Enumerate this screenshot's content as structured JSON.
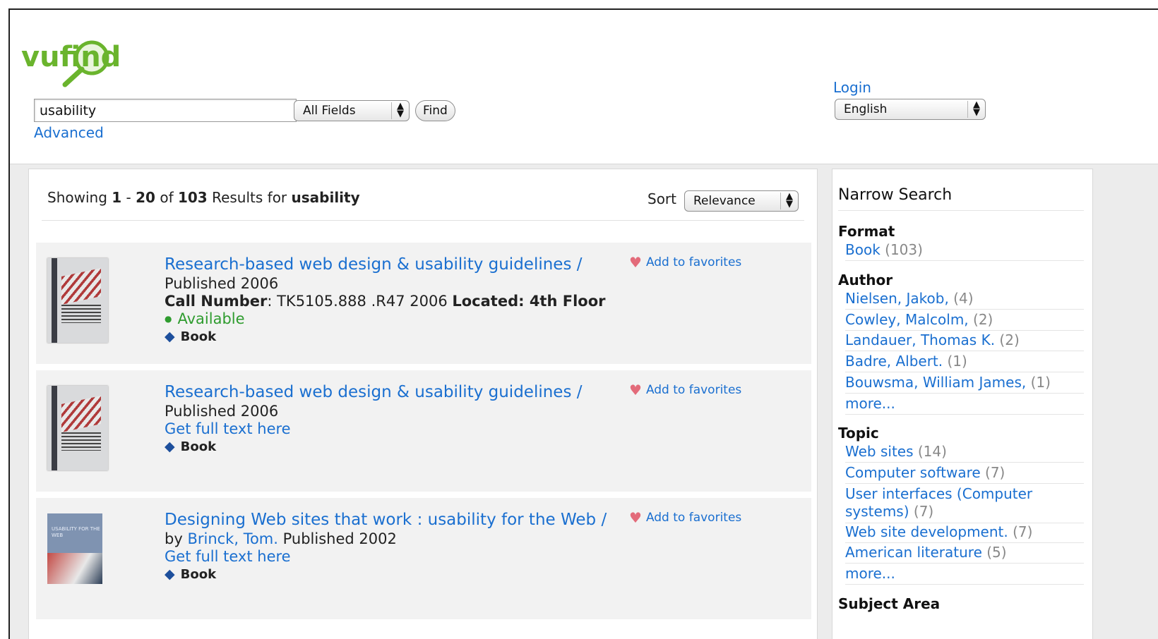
{
  "logo": {
    "text": "vufind"
  },
  "search": {
    "query": "usability",
    "field_select": "All Fields",
    "find_label": "Find",
    "advanced_label": "Advanced"
  },
  "account": {
    "login_label": "Login",
    "language": "English"
  },
  "results": {
    "showing_prefix": "Showing",
    "range_start": "1",
    "range_sep": "-",
    "range_end": "20",
    "of_label": "of",
    "total": "103",
    "results_for": "Results for",
    "query": "usability",
    "sort_label": "Sort",
    "sort_value": "Relevance",
    "items": [
      {
        "title": "Research-based web design & usability guidelines /",
        "published": "Published 2006",
        "call_label": "Call Number",
        "call_number": ": TK5105.888 .R47 2006",
        "located_label": "Located: 4th Floor",
        "status": "Available",
        "format": "Book",
        "favorites": "Add to favorites"
      },
      {
        "title": "Research-based web design & usability guidelines /",
        "published": "Published 2006",
        "fulltext": "Get full text here",
        "format": "Book",
        "favorites": "Add to favorites"
      },
      {
        "title": "Designing Web sites that work : usability for the Web /",
        "by": "by",
        "author": "Brinck, Tom.",
        "published": "Published 2002",
        "fulltext": "Get full text here",
        "format": "Book",
        "favorites": "Add to favorites",
        "cover_text": "USABILITY FOR THE WEB"
      }
    ]
  },
  "facets": {
    "title": "Narrow Search",
    "format": {
      "heading": "Format",
      "items": [
        {
          "label": "Book",
          "count": "(103)"
        }
      ]
    },
    "author": {
      "heading": "Author",
      "items": [
        {
          "label": "Nielsen, Jakob,",
          "count": "(4)"
        },
        {
          "label": "Cowley, Malcolm,",
          "count": "(2)"
        },
        {
          "label": "Landauer, Thomas K.",
          "count": "(2)"
        },
        {
          "label": "Badre, Albert.",
          "count": "(1)"
        },
        {
          "label": "Bouwsma, William James,",
          "count": "(1)"
        }
      ],
      "more": "more..."
    },
    "topic": {
      "heading": "Topic",
      "items": [
        {
          "label": "Web sites",
          "count": "(14)"
        },
        {
          "label": "Computer software",
          "count": "(7)"
        },
        {
          "label": "User interfaces (Computer",
          "label2": "systems)",
          "count": "(7)"
        },
        {
          "label": "Web site development.",
          "count": "(7)"
        },
        {
          "label": "American literature",
          "count": "(5)"
        }
      ],
      "more": "more..."
    },
    "subject_area": {
      "heading": "Subject Area"
    }
  },
  "colors": {
    "link": "#1a6fd0",
    "available": "#2f9c2f",
    "heart": "#e36b7a",
    "logo_green": "#6ab42d"
  }
}
